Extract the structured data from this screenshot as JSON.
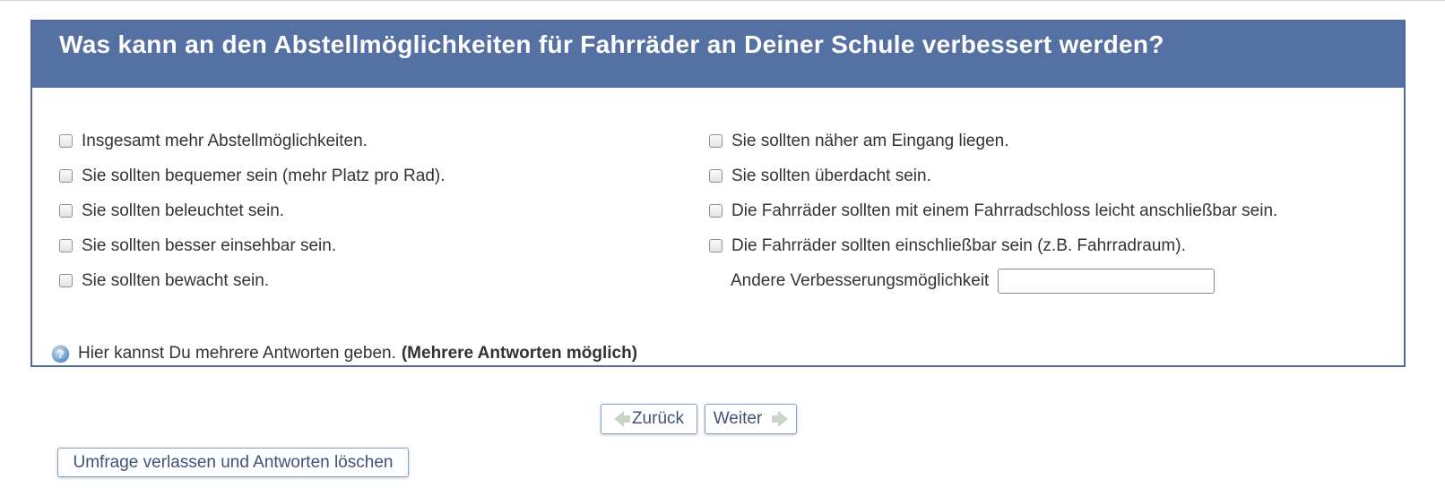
{
  "question": {
    "title": "Was kann an den Abstellmöglichkeiten für Fahrräder an Deiner Schule verbessert werden?"
  },
  "options_left": [
    {
      "label": "Insgesamt mehr Abstellmöglichkeiten.",
      "checked": false
    },
    {
      "label": "Sie sollten bequemer sein (mehr Platz pro Rad).",
      "checked": false
    },
    {
      "label": "Sie sollten beleuchtet sein.",
      "checked": false
    },
    {
      "label": "Sie sollten besser einsehbar sein.",
      "checked": false
    },
    {
      "label": "Sie sollten bewacht sein.",
      "checked": false
    }
  ],
  "options_right": [
    {
      "label": "Sie sollten näher am Eingang liegen.",
      "checked": false
    },
    {
      "label": "Sie sollten überdacht sein.",
      "checked": false
    },
    {
      "label": "Die Fahrräder sollten mit einem Fahrradschloss leicht anschließbar sein.",
      "checked": false
    },
    {
      "label": "Die Fahrräder sollten einschließbar sein (z.B. Fahrradraum).",
      "checked": false
    }
  ],
  "other": {
    "label": "Andere Verbesserungsmöglichkeit",
    "value": ""
  },
  "help": {
    "text": "Hier kannst Du mehrere Antworten geben.",
    "strong": "(Mehrere Antworten möglich)",
    "icon": "help-icon"
  },
  "nav": {
    "back_label": "Zurück",
    "next_label": "Weiter",
    "quit_label": "Umfrage verlassen und Antworten löschen"
  },
  "colors": {
    "header_bg": "#5570a3",
    "border": "#506a9a",
    "button_text": "#3f5277"
  }
}
